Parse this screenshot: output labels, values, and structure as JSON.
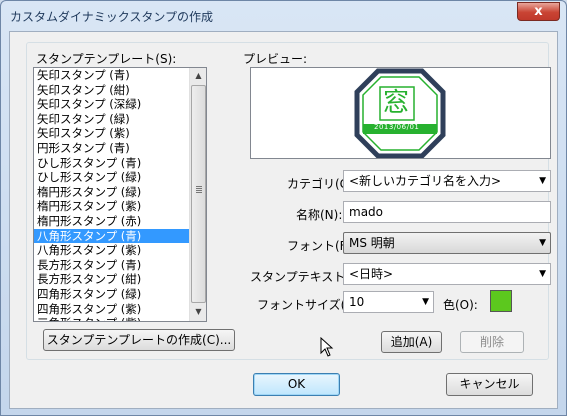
{
  "window": {
    "title": "カスタムダイナミックスタンプの作成",
    "close_glyph": "x"
  },
  "template_list": {
    "label": "スタンプテンプレート(S):",
    "items": [
      "矢印スタンプ (青)",
      "矢印スタンプ (紺)",
      "矢印スタンプ (深緑)",
      "矢印スタンプ (緑)",
      "矢印スタンプ (紫)",
      "円形スタンプ (青)",
      "ひし形スタンプ (青)",
      "ひし形スタンプ (緑)",
      "楕円形スタンプ (緑)",
      "楕円形スタンプ (紫)",
      "楕円形スタンプ (赤)",
      "八角形スタンプ (青)",
      "八角形スタンプ (紫)",
      "長方形スタンプ (青)",
      "長方形スタンプ (紺)",
      "四角形スタンプ (緑)",
      "四角形スタンプ (紫)",
      "三角形スタンプ (紫)"
    ],
    "selected_index": 11,
    "create_button": "スタンプテンプレートの作成(C)..."
  },
  "preview": {
    "label": "プレビュー:",
    "stamp_char": "窓",
    "stamp_date": "2013/06/01",
    "stamp_year_prefix": "2013/6",
    "colors": {
      "frame": "#2f3f5a",
      "green": "#27b12f"
    }
  },
  "form": {
    "category_label": "カテゴリ(G):",
    "category_value": "<新しいカテゴリ名を入力>",
    "name_label": "名称(N):",
    "name_value": "mado",
    "font_label": "フォント(F):",
    "font_value": "MS 明朝",
    "stamp_text_label": "スタンプテキスト(S):",
    "stamp_text_value": "<日時>",
    "font_size_label": "フォントサイズ(O):",
    "font_size_value": "10",
    "color_label": "色(O):",
    "color_value": "#5cc81e",
    "add_button": "追加(A)",
    "delete_button": "削除"
  },
  "footer": {
    "ok": "OK",
    "cancel": "キャンセル"
  }
}
